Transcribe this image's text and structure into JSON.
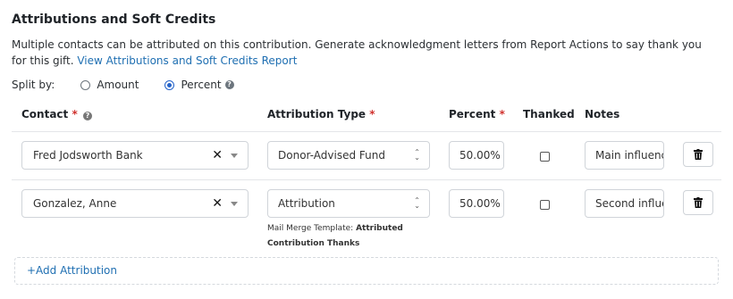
{
  "section": {
    "title": "Attributions and Soft Credits",
    "description": "Multiple contacts can be attributed on this contribution. Generate acknowledgment letters from Report Actions to say thank you for this gift.",
    "report_link": "View Attributions and Soft Credits Report"
  },
  "split": {
    "label": "Split by:",
    "options": [
      {
        "label": "Amount",
        "selected": false
      },
      {
        "label": "Percent",
        "selected": true
      }
    ]
  },
  "table": {
    "headers": {
      "contact": "Contact",
      "attribution_type": "Attribution Type",
      "percent": "Percent",
      "thanked": "Thanked",
      "notes": "Notes"
    },
    "required_marker": "*",
    "rows": [
      {
        "contact": "Fred Jodsworth Bank",
        "attribution_type": "Donor-Advised Fund",
        "percent": "50.00%",
        "thanked": false,
        "notes": "Main influencer"
      },
      {
        "contact": "Gonzalez, Anne",
        "attribution_type": "Attribution",
        "percent": "50.00%",
        "thanked": false,
        "notes": "Second influencer",
        "hint_prefix": "Mail Merge Template:",
        "hint_template": "Attributed Contribution Thanks"
      }
    ]
  },
  "add_button": "+Add Attribution",
  "icons": {
    "clear": "clear-icon",
    "caret": "chevron-down-icon",
    "updown": "updown-chevron-icon",
    "help": "help-circle-icon",
    "trash": "trash-icon"
  },
  "colors": {
    "link": "#1f6fb2",
    "required": "#d0312d",
    "radio_selected": "#2563c9"
  }
}
